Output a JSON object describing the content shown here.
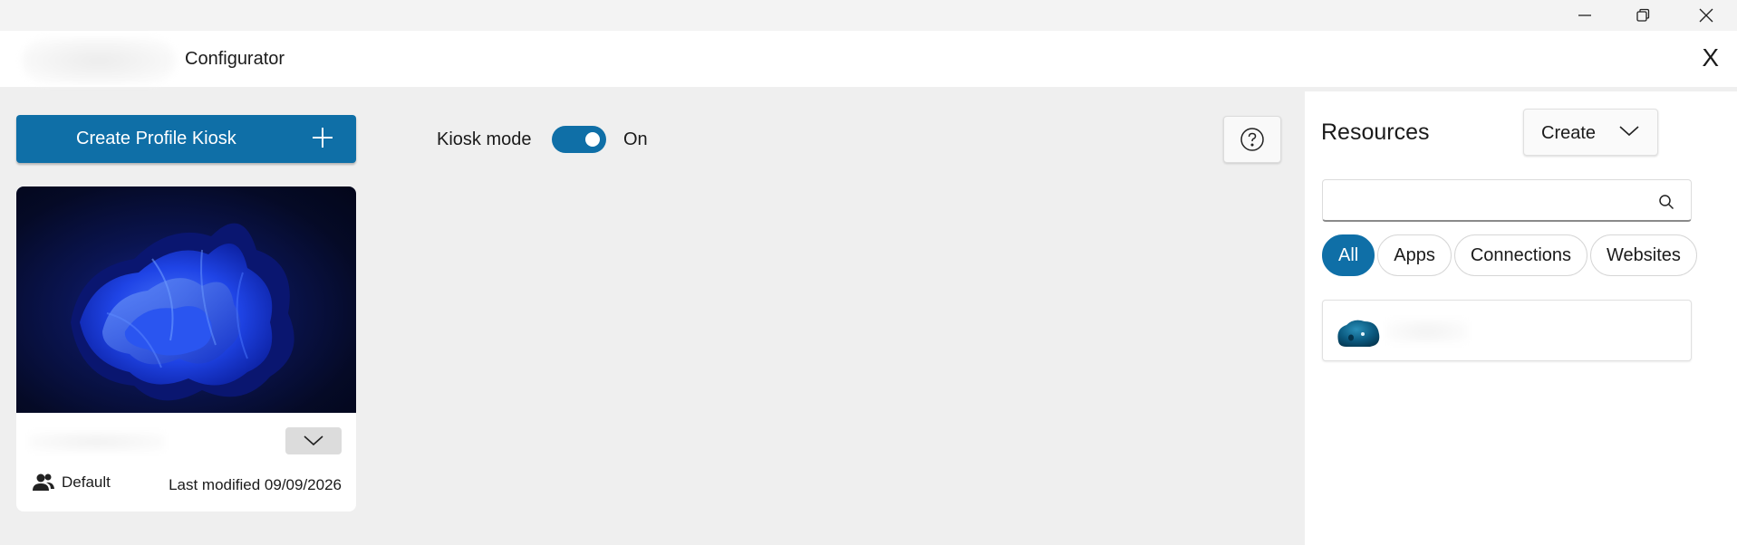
{
  "window": {
    "title": "",
    "minimize_icon": "minimize-icon",
    "restore_icon": "restore-icon",
    "close_icon": "close-icon"
  },
  "app": {
    "title": "Configurator",
    "close_label": "X"
  },
  "toolbar": {
    "create_profile_label": "Create Profile Kiosk",
    "kiosk_mode_label": "Kiosk mode",
    "kiosk_mode_state": "On",
    "kiosk_mode_on": true
  },
  "profile_card": {
    "name": "",
    "account_type": "Default",
    "last_modified": "Last modified 09/09/2026"
  },
  "resources": {
    "title": "Resources",
    "create_label": "Create",
    "search_placeholder": "",
    "search_value": "",
    "filters": [
      {
        "label": "All",
        "active": true
      },
      {
        "label": "Apps",
        "active": false
      },
      {
        "label": "Connections",
        "active": false
      },
      {
        "label": "Websites",
        "active": false
      }
    ],
    "items": [
      {
        "name": "",
        "icon": "app-icon"
      }
    ]
  },
  "colors": {
    "accent": "#0f6fa7",
    "background": "#efefef",
    "panel": "#ffffff"
  }
}
